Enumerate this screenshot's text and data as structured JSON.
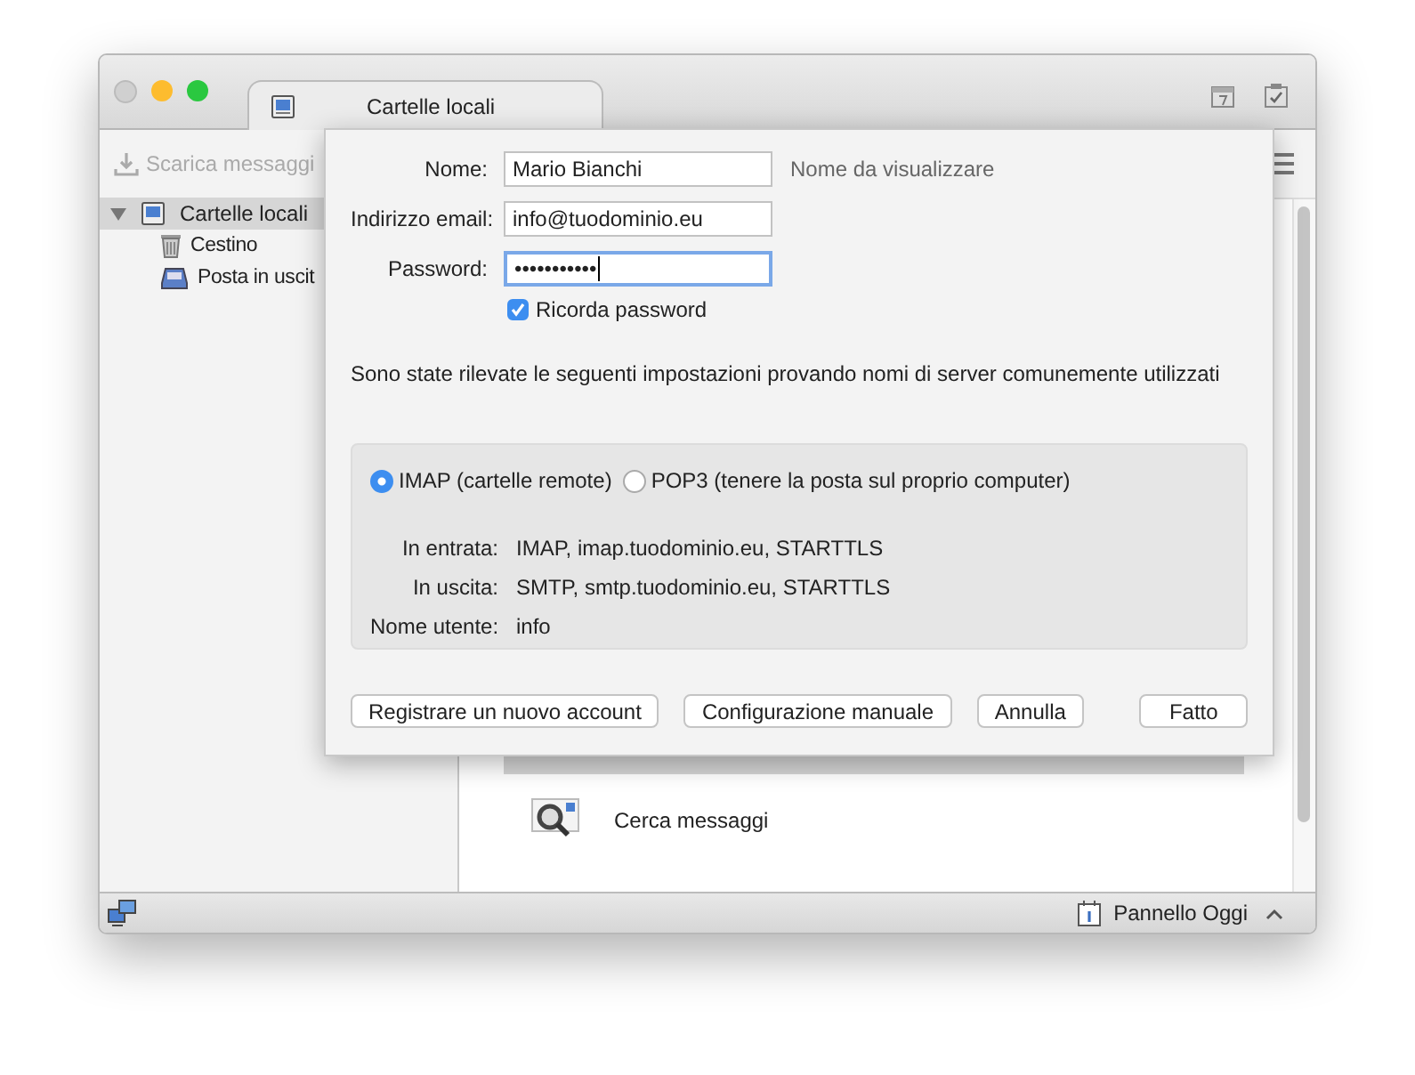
{
  "window": {
    "tab": {
      "title": "Cartelle locali",
      "selected": true
    }
  },
  "toolbar": {
    "get_messages": {
      "label": "Scarica messaggi",
      "disabled": true
    }
  },
  "folders": [
    {
      "label": "Cartelle locali",
      "kind": "account",
      "expanded": true,
      "selected": true,
      "children": [
        {
          "label": "Cestino",
          "kind": "trash",
          "selected": false
        },
        {
          "label": "Posta in uscit",
          "kind": "outbox",
          "selected": false
        }
      ]
    }
  ],
  "content": {
    "actions": [
      {
        "label": "Cerca messaggi"
      }
    ]
  },
  "dialog": {
    "fields": [
      {
        "label": "Nome:",
        "value": "Mario Bianchi",
        "hint": "Nome da visualizzare",
        "focused": false
      },
      {
        "label": "Indirizzo email:",
        "value": "info@tuodominio.eu",
        "focused": false
      },
      {
        "label": "Password:",
        "value": "•••••••••••",
        "focused": true
      }
    ],
    "remember": {
      "label": "Ricorda password",
      "checked": true
    },
    "message": "Sono state rilevate le seguenti impostazioni provando nomi di server comunemente utilizzati",
    "protocols": [
      {
        "label": "IMAP (cartelle remote)",
        "selected": true
      },
      {
        "label": "POP3 (tenere la posta sul proprio computer)",
        "selected": false
      }
    ],
    "settings": [
      {
        "label": "In entrata:",
        "value": "IMAP, imap.tuodominio.eu, STARTTLS"
      },
      {
        "label": "In uscita:",
        "value": "SMTP, smtp.tuodominio.eu, STARTTLS"
      },
      {
        "label": "Nome utente:",
        "value": "info"
      }
    ],
    "buttons": [
      "Registrare un nuovo account",
      "Configurazione manuale",
      "Annulla",
      "Fatto"
    ]
  },
  "status_bar": {
    "today_pane": "Pannello Oggi"
  }
}
